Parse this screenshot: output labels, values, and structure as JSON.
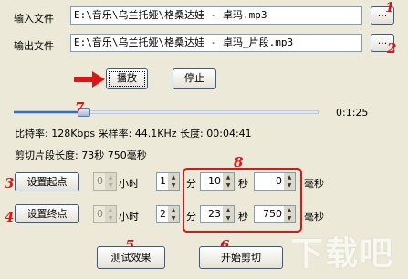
{
  "input": {
    "label": "输入文件",
    "value": "E:\\音乐\\乌兰托娅\\格桑达娃 - 卓玛.mp3",
    "browse": "..."
  },
  "output": {
    "label": "输出文件",
    "value": "E:\\音乐\\乌兰托娅\\格桑达娃 - 卓玛_片段.mp3",
    "browse": "..."
  },
  "controls": {
    "play": "播放",
    "stop": "停止"
  },
  "slider": {
    "position": 0.23,
    "time": "0:1:25"
  },
  "info": {
    "line1": "比特率: 128Kbps  采样率: 44.1KHz  长度: 00:04:41",
    "line2": "剪切片段长度: 73秒 750毫秒"
  },
  "set_start": {
    "button": "设置起点",
    "hours": "0",
    "hours_unit": "小时",
    "minutes": "1",
    "minutes_unit": "分",
    "seconds": "10",
    "seconds_unit": "秒",
    "ms": "0",
    "ms_unit": "毫秒"
  },
  "set_end": {
    "button": "设置终点",
    "hours": "0",
    "hours_unit": "小时",
    "minutes": "2",
    "minutes_unit": "分",
    "seconds": "23",
    "seconds_unit": "秒",
    "ms": "750",
    "ms_unit": "毫秒"
  },
  "actions": {
    "test": "测试效果",
    "cut": "开始剪切"
  },
  "annotations": [
    "1",
    "2",
    "3",
    "4",
    "5",
    "6",
    "7",
    "8"
  ],
  "watermark": "下载吧",
  "colors": {
    "annotation": "#d81818",
    "accent": "#2f6fc7"
  }
}
